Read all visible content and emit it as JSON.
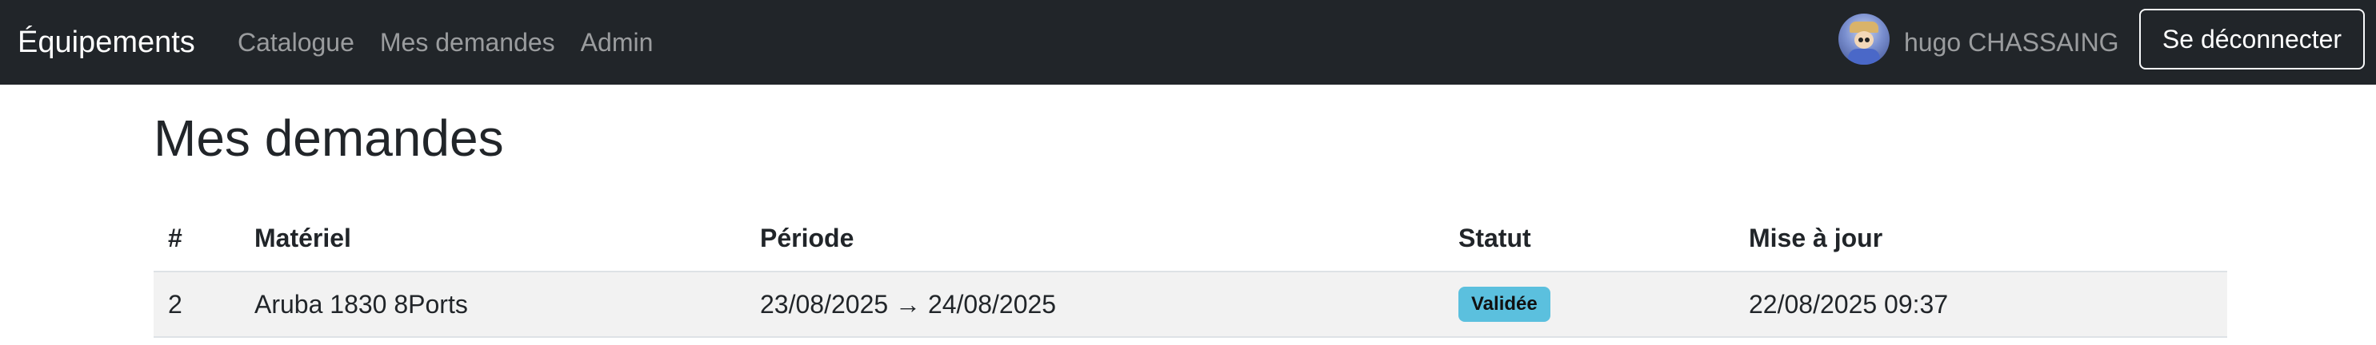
{
  "navbar": {
    "brand": "Équipements",
    "links": [
      "Catalogue",
      "Mes demandes",
      "Admin"
    ],
    "username": "hugo CHASSAING",
    "logout_label": "Se déconnecter"
  },
  "page": {
    "title": "Mes demandes"
  },
  "table": {
    "headers": [
      "#",
      "Matériel",
      "Période",
      "Statut",
      "Mise à jour"
    ],
    "rows": [
      {
        "id": "2",
        "material": "Aruba 1830 8Ports",
        "period": "23/08/2025 → 24/08/2025",
        "status": "Validée",
        "updated": "22/08/2025 09:37"
      }
    ]
  },
  "colors": {
    "navbar_bg": "#212529",
    "status_badge_bg": "#5bc0de",
    "row_bg": "#f2f2f2"
  }
}
